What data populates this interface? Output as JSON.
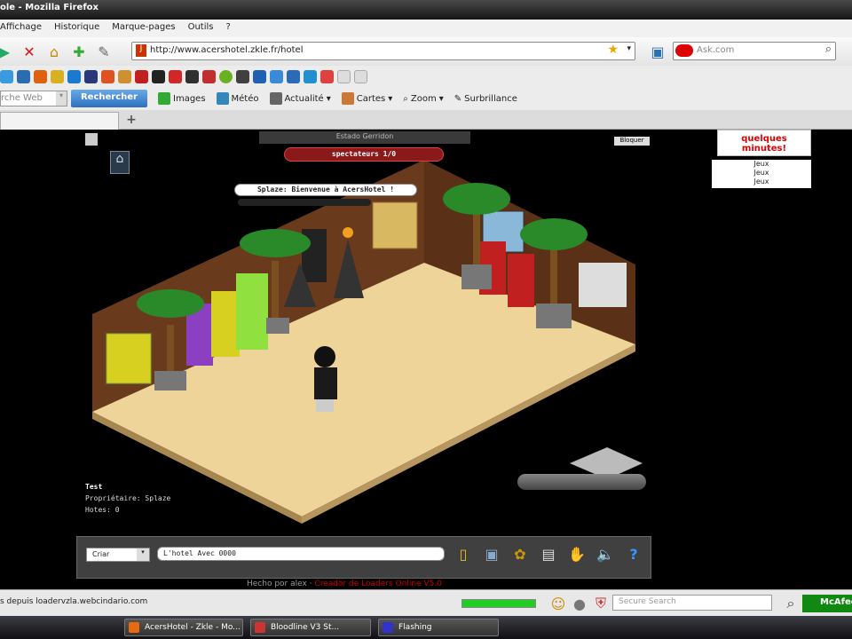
{
  "window": {
    "title": "ole - Mozilla Firefox"
  },
  "menu": [
    "Affichage",
    "Historique",
    "Marque-pages",
    "Outils",
    "?"
  ],
  "nav": {
    "url": "http://www.acershotel.zkle.fr/hotel",
    "ask_placeholder": "Ask.com"
  },
  "toolbar2": {
    "search_placeholder": "rche Web",
    "search_button": "Rechercher",
    "items": [
      "Images",
      "Météo",
      "Actualité",
      "Cartes",
      "Zoom",
      "Surbrillance"
    ]
  },
  "game": {
    "estado": "Estado Gerridon",
    "bloquer": "Bloquer",
    "spectators": "spectateurs 1/0",
    "welcome": "Splaze: Bienvenue à AcersHotel !",
    "notice": "quelques minutes!",
    "jeux": [
      "Jeux",
      "Jeux",
      "Jeux"
    ],
    "room_name": "Test",
    "owner": "Propriétaire: Splaze",
    "hotes": "Hotes: 0",
    "shout_mode": "Criar",
    "chat_value": "L'hotel Avec 0000",
    "credit_prefix": "Hecho por alex ·",
    "credit_link": "Creador de Loaders Online V5.0"
  },
  "status": {
    "text": "s depuis loadervzla.webcindario.com",
    "progress_percent": 100,
    "secure_search_placeholder": "Secure Search",
    "mcafee": "McAfee"
  },
  "taskbar": [
    "AcersHotel - Zkle - Mo...",
    "Bloodline V3 St...",
    "Flashing"
  ],
  "colors": {
    "accent": "#2d6fc0",
    "ribbon": "#8a1a1a",
    "floor": "#efd49a",
    "wall": "#6a3a1c"
  }
}
